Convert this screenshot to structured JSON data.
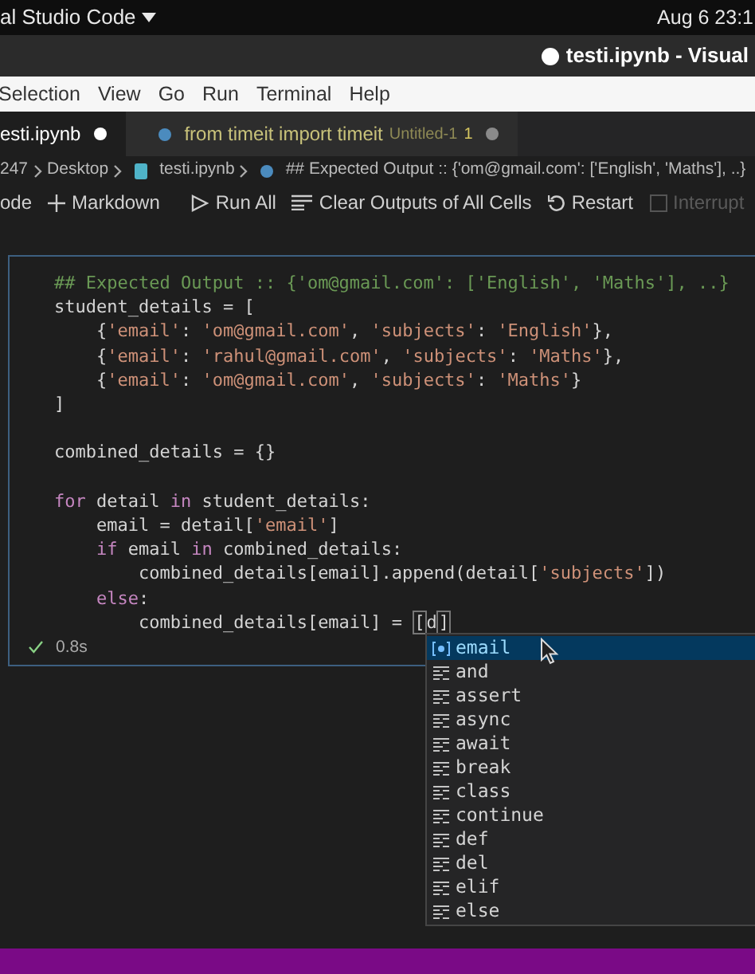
{
  "top_bar": {
    "app": "al Studio Code",
    "clock": "Aug 6  23:1"
  },
  "window": {
    "title": "testi.ipynb - Visual",
    "modified": true
  },
  "menu": [
    "Selection",
    "View",
    "Go",
    "Run",
    "Terminal",
    "Help"
  ],
  "tabs": [
    {
      "label": "esti.ipynb",
      "selected": true,
      "modified": true
    },
    {
      "label": "from timeit import timeit",
      "description": "Untitled-1",
      "problems": "1",
      "selected": false,
      "modified": true
    }
  ],
  "breadcrumbs": [
    {
      "label": "247",
      "kind": "folder"
    },
    {
      "label": "Desktop",
      "kind": "folder"
    },
    {
      "label": "testi.ipynb",
      "kind": "notebook"
    },
    {
      "label": "## Expected Output :: {'om@gmail.com': ['English', 'Maths'], ..}",
      "kind": "cell"
    }
  ],
  "toolbar": [
    {
      "label": "ode",
      "kind": "code",
      "disabled": false
    },
    {
      "label": "Markdown",
      "kind": "markdown",
      "disabled": false
    },
    {
      "label": "Run All",
      "kind": "run",
      "disabled": false
    },
    {
      "label": "Clear Outputs of All Cells",
      "kind": "clear",
      "disabled": false
    },
    {
      "label": "Restart",
      "kind": "restart",
      "disabled": false
    },
    {
      "label": "Interrupt",
      "kind": "interrupt",
      "disabled": true
    }
  ],
  "cell": {
    "succeeded": true,
    "duration": "0.8s",
    "lines": [
      {
        "kind": "code",
        "tokens": [
          {
            "kind": "comment",
            "text": "## Expected Output :: {'om@gmail.com': ['English', 'Maths'], ..}"
          }
        ]
      },
      {
        "kind": "code",
        "tokens": [
          {
            "kind": "text",
            "text": "student_details = ["
          }
        ]
      },
      {
        "kind": "code",
        "tokens": [
          {
            "kind": "text",
            "text": "    {"
          },
          {
            "kind": "string",
            "text": "'email'"
          },
          {
            "kind": "text",
            "text": ": "
          },
          {
            "kind": "string",
            "text": "'om@gmail.com'"
          },
          {
            "kind": "text",
            "text": ", "
          },
          {
            "kind": "string",
            "text": "'subjects'"
          },
          {
            "kind": "text",
            "text": ": "
          },
          {
            "kind": "string",
            "text": "'English'"
          },
          {
            "kind": "text",
            "text": "},"
          }
        ]
      },
      {
        "kind": "code",
        "tokens": [
          {
            "kind": "text",
            "text": "    {"
          },
          {
            "kind": "string",
            "text": "'email'"
          },
          {
            "kind": "text",
            "text": ": "
          },
          {
            "kind": "string",
            "text": "'rahul@gmail.com'"
          },
          {
            "kind": "text",
            "text": ", "
          },
          {
            "kind": "string",
            "text": "'subjects'"
          },
          {
            "kind": "text",
            "text": ": "
          },
          {
            "kind": "string",
            "text": "'Maths'"
          },
          {
            "kind": "text",
            "text": "},"
          }
        ]
      },
      {
        "kind": "code",
        "tokens": [
          {
            "kind": "text",
            "text": "    {"
          },
          {
            "kind": "string",
            "text": "'email'"
          },
          {
            "kind": "text",
            "text": ": "
          },
          {
            "kind": "string",
            "text": "'om@gmail.com'"
          },
          {
            "kind": "text",
            "text": ", "
          },
          {
            "kind": "string",
            "text": "'subjects'"
          },
          {
            "kind": "text",
            "text": ": "
          },
          {
            "kind": "string",
            "text": "'Maths'"
          },
          {
            "kind": "text",
            "text": "}"
          }
        ]
      },
      {
        "kind": "code",
        "tokens": [
          {
            "kind": "text",
            "text": "]"
          }
        ]
      },
      {
        "kind": "blank"
      },
      {
        "kind": "code",
        "tokens": [
          {
            "kind": "text",
            "text": "combined_details = {}"
          }
        ]
      },
      {
        "kind": "blank"
      },
      {
        "kind": "code",
        "tokens": [
          {
            "kind": "keyword",
            "text": "for"
          },
          {
            "kind": "text",
            "text": " detail "
          },
          {
            "kind": "keyword",
            "text": "in"
          },
          {
            "kind": "text",
            "text": " student_details:"
          }
        ]
      },
      {
        "kind": "code",
        "tokens": [
          {
            "kind": "text",
            "text": "    email = detail["
          },
          {
            "kind": "string",
            "text": "'email'"
          },
          {
            "kind": "text",
            "text": "]"
          }
        ]
      },
      {
        "kind": "code",
        "tokens": [
          {
            "kind": "keyword",
            "text": "    if"
          },
          {
            "kind": "text",
            "text": " email "
          },
          {
            "kind": "keyword",
            "text": "in"
          },
          {
            "kind": "text",
            "text": " combined_details:"
          }
        ]
      },
      {
        "kind": "code",
        "tokens": [
          {
            "kind": "text",
            "text": "        combined_details[email].append(detail["
          },
          {
            "kind": "string",
            "text": "'subjects'"
          },
          {
            "kind": "text",
            "text": "])"
          }
        ]
      },
      {
        "kind": "code",
        "tokens": [
          {
            "kind": "keyword",
            "text": "    else"
          },
          {
            "kind": "text",
            "text": ":"
          }
        ]
      },
      {
        "kind": "code",
        "tokens": [
          {
            "kind": "text",
            "text": "        combined_details[email] = "
          },
          {
            "kind": "bracket",
            "text": "["
          },
          {
            "kind": "text",
            "text": "d"
          },
          {
            "kind": "bracket",
            "text": "]"
          }
        ]
      }
    ]
  },
  "suggestions": [
    {
      "label": "email",
      "kind": "variable",
      "selected": true
    },
    {
      "label": "and",
      "kind": "keyword",
      "selected": false
    },
    {
      "label": "assert",
      "kind": "keyword",
      "selected": false
    },
    {
      "label": "async",
      "kind": "keyword",
      "selected": false
    },
    {
      "label": "await",
      "kind": "keyword",
      "selected": false
    },
    {
      "label": "break",
      "kind": "keyword",
      "selected": false
    },
    {
      "label": "class",
      "kind": "keyword",
      "selected": false
    },
    {
      "label": "continue",
      "kind": "keyword",
      "selected": false
    },
    {
      "label": "def",
      "kind": "keyword",
      "selected": false
    },
    {
      "label": "del",
      "kind": "keyword",
      "selected": false
    },
    {
      "label": "elif",
      "kind": "keyword",
      "selected": false
    },
    {
      "label": "else",
      "kind": "keyword",
      "selected": false
    }
  ]
}
